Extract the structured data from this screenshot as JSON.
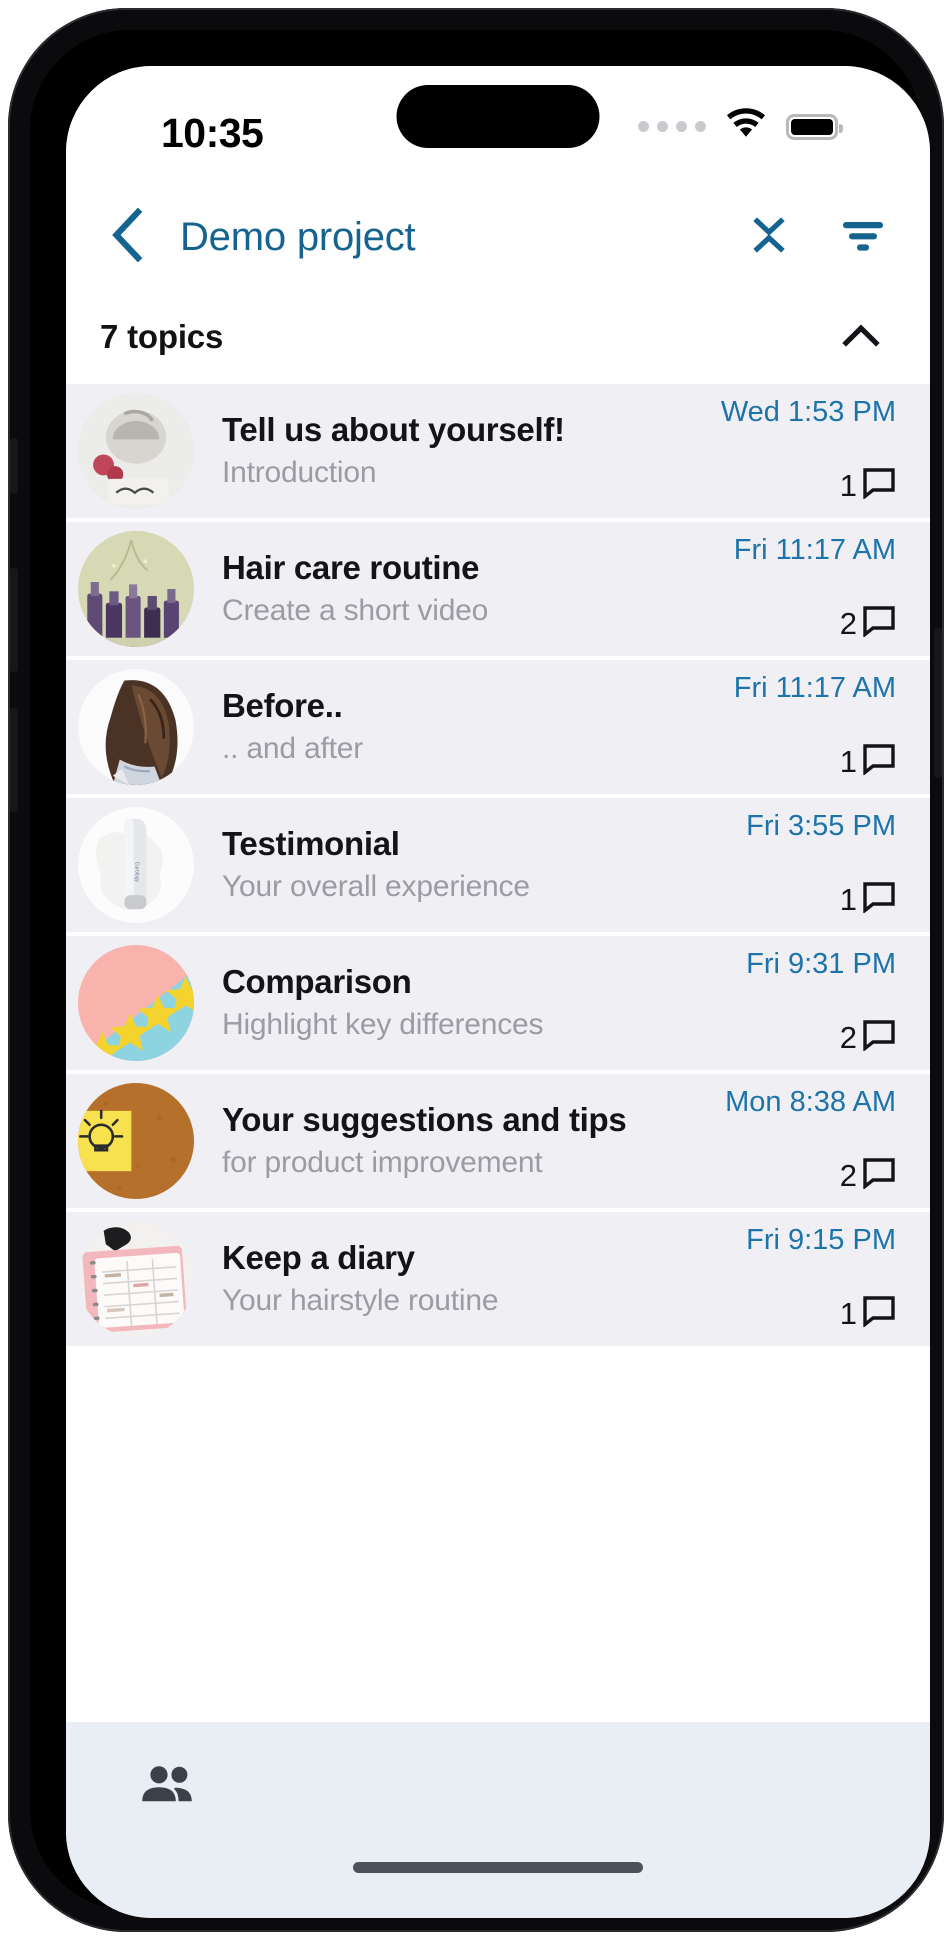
{
  "status_bar": {
    "time": "10:35",
    "cellular_icon": "cellular-dots-icon",
    "wifi_icon": "wifi-icon",
    "battery_icon": "battery-full-icon"
  },
  "nav": {
    "back_icon": "chevron-left-icon",
    "title": "Demo project",
    "collapse_icon": "collapse-all-icon",
    "filter_icon": "filter-icon",
    "accent_color": "#15648f"
  },
  "section": {
    "title": "7 topics",
    "count": 7,
    "toggle_icon": "chevron-up-icon",
    "expanded": true
  },
  "topics": [
    {
      "title": "Tell us about yourself!",
      "subtitle": "Introduction",
      "time": "Wed 1:53 PM",
      "comments": "1",
      "comment_icon": "comment-bubble-icon",
      "avatar_icon": "welcome-sign-photo"
    },
    {
      "title": "Hair care routine",
      "subtitle": "Create a short video",
      "time": "Fri 11:17 AM",
      "comments": "2",
      "comment_icon": "comment-bubble-icon",
      "avatar_icon": "hair-products-photo"
    },
    {
      "title": "Before..",
      "subtitle": ".. and after",
      "time": "Fri 11:17 AM",
      "comments": "1",
      "comment_icon": "comment-bubble-icon",
      "avatar_icon": "woman-hair-photo"
    },
    {
      "title": "Testimonial",
      "subtitle": "Your overall experience",
      "time": "Fri 3:55 PM",
      "comments": "1",
      "comment_icon": "comment-bubble-icon",
      "avatar_icon": "product-tube-photo"
    },
    {
      "title": "Comparison",
      "subtitle": "Highlight key differences",
      "time": "Fri 9:31 PM",
      "comments": "2",
      "comment_icon": "comment-bubble-icon",
      "avatar_icon": "yellow-stars-photo"
    },
    {
      "title": "Your suggestions and tips",
      "subtitle": "for product improvement",
      "time": "Mon 8:38 AM",
      "comments": "2",
      "comment_icon": "comment-bubble-icon",
      "avatar_icon": "lightbulb-sticky-note-photo"
    },
    {
      "title": "Keep a diary",
      "subtitle": "Your hairstyle routine",
      "time": "Fri 9:15 PM",
      "comments": "1",
      "comment_icon": "comment-bubble-icon",
      "avatar_icon": "pink-notebook-photo"
    }
  ],
  "bottom_bar": {
    "people_icon": "people-icon"
  },
  "colors": {
    "accent": "#15648f",
    "time_link": "#1d74ab",
    "row_bg": "#f0f0f4",
    "bottom_bar_bg": "#e8eef4",
    "subtitle": "#9b9ba3"
  }
}
